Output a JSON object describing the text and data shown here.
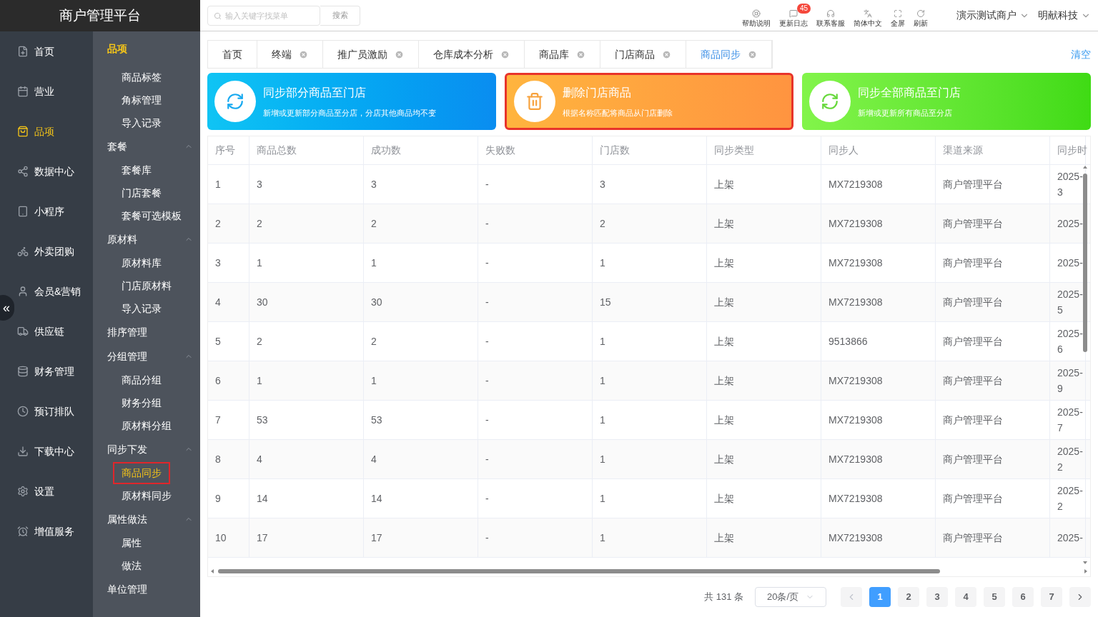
{
  "brand": {
    "title": "商户管理平台"
  },
  "search": {
    "placeholder": "输入关键字找菜单",
    "button": "搜索"
  },
  "toolbar": [
    {
      "kind": "help",
      "label": "帮助说明"
    },
    {
      "kind": "log",
      "label": "更新日志",
      "badge": "45"
    },
    {
      "kind": "service",
      "label": "联系客服"
    },
    {
      "kind": "language",
      "label": "简体中文"
    },
    {
      "kind": "fullscreen",
      "label": "全屏"
    },
    {
      "kind": "refresh",
      "label": "刷新"
    }
  ],
  "account_menus": [
    "演示测试商户",
    "明献科技"
  ],
  "collapse_toggle": "«",
  "nav": [
    {
      "kind": "home",
      "label": "首页",
      "selected": false
    },
    {
      "kind": "calendar",
      "label": "营业",
      "selected": false
    },
    {
      "kind": "bag",
      "label": "品项",
      "selected": true
    },
    {
      "kind": "share",
      "label": "数据中心",
      "selected": false
    },
    {
      "kind": "phone",
      "label": "小程序",
      "selected": false
    },
    {
      "kind": "bike",
      "label": "外卖团购",
      "selected": false
    },
    {
      "kind": "user",
      "label": "会员&营销",
      "selected": false
    },
    {
      "kind": "truck",
      "label": "供应链",
      "selected": false
    },
    {
      "kind": "database",
      "label": "财务管理",
      "selected": false
    },
    {
      "kind": "clock",
      "label": "预订排队",
      "selected": false
    },
    {
      "kind": "download",
      "label": "下载中心",
      "selected": false
    },
    {
      "kind": "settings",
      "label": "设置",
      "selected": false
    },
    {
      "kind": "alarm",
      "label": "增值服务",
      "selected": false
    }
  ],
  "submenu": {
    "title": "品项",
    "sections": [
      {
        "children": [
          {
            "label": "商品标签",
            "selected": false
          },
          {
            "label": "角标管理",
            "selected": false
          },
          {
            "label": "导入记录",
            "selected": false
          }
        ]
      },
      {
        "label": "套餐",
        "expanded": true,
        "children": [
          {
            "label": "套餐库",
            "selected": false
          },
          {
            "label": "门店套餐",
            "selected": false
          },
          {
            "label": "套餐可选模板",
            "selected": false
          }
        ]
      },
      {
        "label": "原材料",
        "expanded": true,
        "children": [
          {
            "label": "原材料库",
            "selected": false
          },
          {
            "label": "门店原材料",
            "selected": false
          },
          {
            "label": "导入记录",
            "selected": false
          }
        ]
      },
      {
        "label": "排序管理"
      },
      {
        "label": "分组管理",
        "expanded": true,
        "children": [
          {
            "label": "商品分组",
            "selected": false
          },
          {
            "label": "财务分组",
            "selected": false
          },
          {
            "label": "原材料分组",
            "selected": false
          }
        ]
      },
      {
        "label": "同步下发",
        "expanded": true,
        "children": [
          {
            "label": "商品同步",
            "selected": true
          },
          {
            "label": "原材料同步",
            "selected": false
          }
        ]
      },
      {
        "label": "属性做法",
        "expanded": true,
        "children": [
          {
            "label": "属性",
            "selected": false
          },
          {
            "label": "做法",
            "selected": false
          }
        ]
      },
      {
        "label": "单位管理"
      }
    ]
  },
  "tabs": [
    {
      "label": "首页",
      "closable": false,
      "selected": false
    },
    {
      "label": "终端",
      "closable": true,
      "selected": false
    },
    {
      "label": "推广员激励",
      "closable": true,
      "selected": false
    },
    {
      "label": "仓库成本分析",
      "closable": true,
      "selected": false
    },
    {
      "label": "商品库",
      "closable": true,
      "selected": false
    },
    {
      "label": "门店商品",
      "closable": true,
      "selected": false
    },
    {
      "label": "商品同步",
      "closable": true,
      "selected": true
    }
  ],
  "clear_link": "清空",
  "action_cards": [
    {
      "kind": "sync-part",
      "title": "同步部分商品至门店",
      "description": "新增或更新部分商品至分店，分店其他商品均不变",
      "highlighted": false
    },
    {
      "kind": "delete",
      "title": "删除门店商品",
      "description": "根据名称匹配将商品从门店删除",
      "highlighted": true
    },
    {
      "kind": "sync-all",
      "title": "同步全部商品至门店",
      "description": "新增或更新所有商品至分店",
      "highlighted": false
    }
  ],
  "table": {
    "columns": [
      "序号",
      "商品总数",
      "成功数",
      "失败数",
      "门店数",
      "同步类型",
      "同步人",
      "渠道来源",
      "同步时"
    ],
    "rows": [
      [
        "1",
        "3",
        "3",
        "-",
        "3",
        "上架",
        "MX7219308",
        "商户管理平台",
        "2025-\n3"
      ],
      [
        "2",
        "2",
        "2",
        "-",
        "2",
        "上架",
        "MX7219308",
        "商户管理平台",
        "2025-"
      ],
      [
        "3",
        "1",
        "1",
        "-",
        "1",
        "上架",
        "MX7219308",
        "商户管理平台",
        "2025-"
      ],
      [
        "4",
        "30",
        "30",
        "-",
        "15",
        "上架",
        "MX7219308",
        "商户管理平台",
        "2025-\n5"
      ],
      [
        "5",
        "2",
        "2",
        "-",
        "1",
        "上架",
        "9513866",
        "商户管理平台",
        "2025-\n6"
      ],
      [
        "6",
        "1",
        "1",
        "-",
        "1",
        "上架",
        "MX7219308",
        "商户管理平台",
        "2025-\n9"
      ],
      [
        "7",
        "53",
        "53",
        "-",
        "1",
        "上架",
        "MX7219308",
        "商户管理平台",
        "2025-\n7"
      ],
      [
        "8",
        "4",
        "4",
        "-",
        "1",
        "上架",
        "MX7219308",
        "商户管理平台",
        "2025-\n2"
      ],
      [
        "9",
        "14",
        "14",
        "-",
        "1",
        "上架",
        "MX7219308",
        "商户管理平台",
        "2025-\n2"
      ],
      [
        "10",
        "17",
        "17",
        "-",
        "1",
        "上架",
        "MX7219308",
        "商户管理平台",
        "2025-"
      ]
    ]
  },
  "pagination": {
    "total": "共 131 条",
    "page_size": "20条/页",
    "pages": [
      {
        "label": "1",
        "selected": true
      },
      {
        "label": "2",
        "selected": false
      },
      {
        "label": "3",
        "selected": false
      },
      {
        "label": "4",
        "selected": false
      },
      {
        "label": "5",
        "selected": false
      },
      {
        "label": "6",
        "selected": false
      },
      {
        "label": "7",
        "selected": false
      }
    ]
  }
}
